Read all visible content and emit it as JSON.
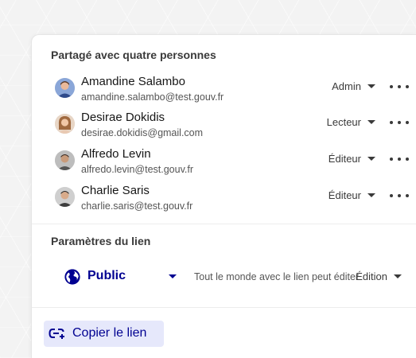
{
  "share": {
    "title": "Partagé avec quatre personnes",
    "members": [
      {
        "name": "Amandine Salambo",
        "email": "amandine.salambo@test.gouv.fr",
        "role": "Admin"
      },
      {
        "name": "Desirae Dokidis",
        "email": "desirae.dokidis@gmail.com",
        "role": "Lecteur"
      },
      {
        "name": "Alfredo Levin",
        "email": "alfredo.levin@test.gouv.fr",
        "role": "Éditeur"
      },
      {
        "name": "Charlie Saris",
        "email": "charlie.saris@test.gouv.fr",
        "role": "Éditeur"
      }
    ]
  },
  "link": {
    "title": "Paramètres du lien",
    "visibility": "Public",
    "description": "Tout le monde avec le lien peut éditer",
    "permission": "Édition"
  },
  "copy": {
    "label": "Copier le lien"
  },
  "colors": {
    "accent": "#000091",
    "accent_bg": "#e6e8fb"
  }
}
